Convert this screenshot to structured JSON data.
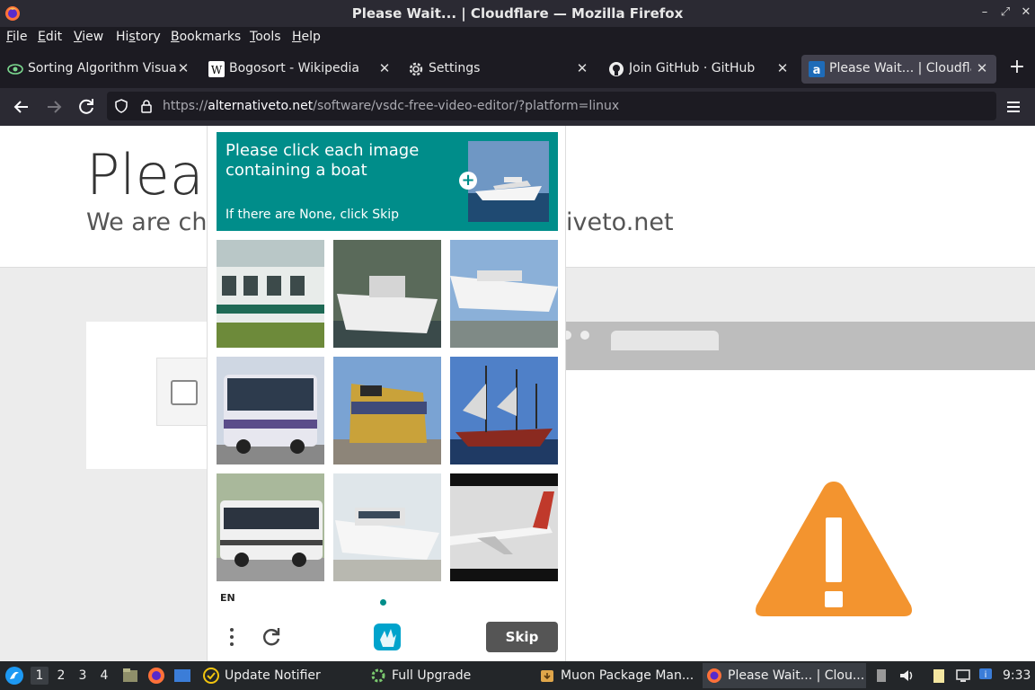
{
  "window": {
    "title": "Please Wait... | Cloudflare — Mozilla Firefox"
  },
  "menu": {
    "items": [
      {
        "label": "File",
        "ul": "F",
        "rest": "ile"
      },
      {
        "label": "Edit",
        "ul": "E",
        "rest": "dit"
      },
      {
        "label": "View",
        "ul": "V",
        "rest": "iew"
      },
      {
        "label": "History",
        "ul": "s",
        "pre": "Hi",
        "rest": "tory"
      },
      {
        "label": "Bookmarks",
        "ul": "B",
        "rest": "ookmarks"
      },
      {
        "label": "Tools",
        "ul": "T",
        "rest": "ools"
      },
      {
        "label": "Help",
        "ul": "H",
        "rest": "elp"
      }
    ]
  },
  "tabs": [
    {
      "label": "Sorting Algorithm Visual",
      "icon": "eye-icon"
    },
    {
      "label": "Bogosort - Wikipedia",
      "icon": "wikipedia-icon"
    },
    {
      "label": "Settings",
      "icon": "gear-icon"
    },
    {
      "label": "Join GitHub · GitHub",
      "icon": "github-icon"
    },
    {
      "label": "Please Wait... | Cloudflar",
      "icon": "alternativeto-icon",
      "active": true
    }
  ],
  "nav": {
    "url_prefix": "https://",
    "url_domain": "alternativeto.net",
    "url_path": "/software/vsdc-free-video-editor/?platform=linux"
  },
  "page": {
    "heading": "Pleas",
    "subheading_left": "We are ch",
    "subheading_right": "iveto.net"
  },
  "captcha": {
    "prompt": "Please click each image containing a boat",
    "hint": "If there are None, click Skip",
    "language": "EN",
    "skip_label": "Skip",
    "images": [
      "train",
      "boat",
      "boat",
      "bus",
      "locomotive",
      "sailing-ship",
      "bus",
      "boat",
      "airplane"
    ]
  },
  "taskbar": {
    "workspaces": [
      "1",
      "2",
      "3",
      "4"
    ],
    "tasks": [
      {
        "label": "Update Notifier"
      },
      {
        "label": "Full Upgrade"
      },
      {
        "label": "Muon Package Man..."
      },
      {
        "label": "Please Wait... | Clou..."
      }
    ],
    "clock": "9:33"
  },
  "colors": {
    "captcha_accent": "#008d8a",
    "warning": "#f3942f"
  }
}
